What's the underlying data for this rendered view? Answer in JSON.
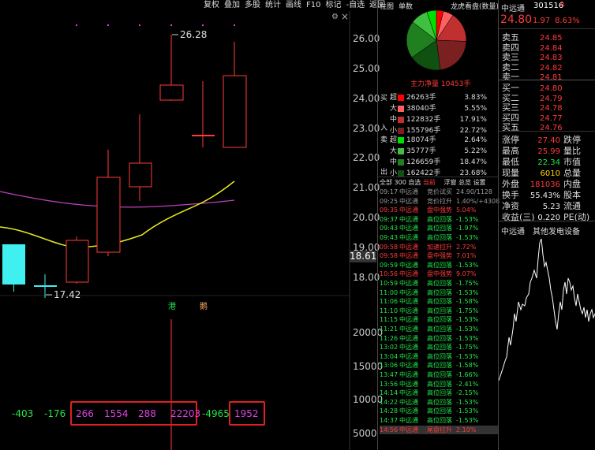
{
  "toolbar": {
    "items": [
      "复权",
      "叠加",
      "多股",
      "统计",
      "画线",
      "F10",
      "标记",
      "-自选",
      "返回"
    ]
  },
  "chart": {
    "price_axis": [
      "26.00",
      "25.00",
      "24.00",
      "23.00",
      "22.00",
      "21.00",
      "20.00",
      "19.00",
      "18.00"
    ],
    "current_price_tag": "18.61",
    "high_annot": "26.28",
    "low_annot": "17.42",
    "volume_axis": [
      "20000",
      "15000",
      "10000",
      "5000"
    ],
    "markers": {
      "gang": "港",
      "jing": "鹅"
    },
    "footer_values": [
      "-403",
      "-176",
      "266",
      "1554",
      "288",
      "22203",
      "-4965",
      "1952"
    ]
  },
  "mid": {
    "tabs": [
      "柱图",
      "单数"
    ],
    "pie_title": "龙虎看盘(数量)",
    "net_flow": "主力净量 10453手",
    "buy_label": "买",
    "sell_label": "卖",
    "in_label": "入",
    "out_label": "出",
    "buy_rows": [
      {
        "size": "超",
        "vol": "26263手",
        "pct": "3.83%",
        "color": "#ff0000"
      },
      {
        "size": "大",
        "vol": "38040手",
        "pct": "5.55%",
        "color": "#ff6060"
      },
      {
        "size": "中",
        "vol": "122832手",
        "pct": "17.91%",
        "color": "#c03030"
      },
      {
        "size": "小",
        "vol": "155796手",
        "pct": "22.72%",
        "color": "#7a2020"
      }
    ],
    "sell_rows": [
      {
        "size": "超",
        "vol": "18074手",
        "pct": "2.64%",
        "color": "#00e000"
      },
      {
        "size": "大",
        "vol": "35777手",
        "pct": "5.22%",
        "color": "#40c040"
      },
      {
        "size": "中",
        "vol": "126659手",
        "pct": "18.47%",
        "color": "#208020"
      },
      {
        "size": "小",
        "vol": "162422手",
        "pct": "23.68%",
        "color": "#105010"
      }
    ],
    "list_tabs": [
      "全部",
      "300",
      "自选",
      "当前",
      "浮窗",
      "总览",
      "设置"
    ],
    "events": [
      {
        "time": "09:17",
        "name": "中远通",
        "desc": "竞价试买",
        "val": "24.90/1128",
        "c": "gray"
      },
      {
        "time": "09:25",
        "name": "中远通",
        "desc": "竞价拉升",
        "val": "1.40%/+4308",
        "c": "gray"
      },
      {
        "time": "09:35",
        "name": "中远通",
        "desc": "盘中强势",
        "val": "5.04%",
        "c": "red"
      },
      {
        "time": "09:37",
        "name": "中远通",
        "desc": "高位回落",
        "val": "-1.53%",
        "c": "green"
      },
      {
        "time": "09:43",
        "name": "中远通",
        "desc": "高位回落",
        "val": "-1.97%",
        "c": "green"
      },
      {
        "time": "09:43",
        "name": "中远通",
        "desc": "高位回落",
        "val": "-1.53%",
        "c": "green"
      },
      {
        "time": "09:58",
        "name": "中远通",
        "desc": "加速拉升",
        "val": "2.72%",
        "c": "red"
      },
      {
        "time": "09:58",
        "name": "中远通",
        "desc": "盘中强势",
        "val": "7.01%",
        "c": "red"
      },
      {
        "time": "09:59",
        "name": "中远通",
        "desc": "高位回落",
        "val": "-1.53%",
        "c": "green"
      },
      {
        "time": "10:56",
        "name": "中远通",
        "desc": "盘中强势",
        "val": "9.07%",
        "c": "red"
      },
      {
        "time": "10:59",
        "name": "中远通",
        "desc": "高位回落",
        "val": "-1.75%",
        "c": "green"
      },
      {
        "time": "11:00",
        "name": "中远通",
        "desc": "高位回落",
        "val": "-1.53%",
        "c": "green"
      },
      {
        "time": "11:06",
        "name": "中远通",
        "desc": "高位回落",
        "val": "-1.58%",
        "c": "green"
      },
      {
        "time": "11:10",
        "name": "中远通",
        "desc": "高位回落",
        "val": "-1.75%",
        "c": "green"
      },
      {
        "time": "11:15",
        "name": "中远通",
        "desc": "高位回落",
        "val": "-1.53%",
        "c": "green"
      },
      {
        "time": "11:21",
        "name": "中远通",
        "desc": "高位回落",
        "val": "-1.53%",
        "c": "green"
      },
      {
        "time": "11:26",
        "name": "中远通",
        "desc": "高位回落",
        "val": "-1.53%",
        "c": "green"
      },
      {
        "time": "13:02",
        "name": "中远通",
        "desc": "高位回落",
        "val": "-1.75%",
        "c": "green"
      },
      {
        "time": "13:04",
        "name": "中远通",
        "desc": "高位回落",
        "val": "-1.53%",
        "c": "green"
      },
      {
        "time": "13:06",
        "name": "中远通",
        "desc": "高位回落",
        "val": "-1.58%",
        "c": "green"
      },
      {
        "time": "13:47",
        "name": "中远通",
        "desc": "高位回落",
        "val": "-1.66%",
        "c": "green"
      },
      {
        "time": "13:56",
        "name": "中远通",
        "desc": "高位回落",
        "val": "-2.41%",
        "c": "green"
      },
      {
        "time": "14:14",
        "name": "中远通",
        "desc": "高位回落",
        "val": "-2.15%",
        "c": "green"
      },
      {
        "time": "14:22",
        "name": "中远通",
        "desc": "高位回落",
        "val": "-1.53%",
        "c": "green"
      },
      {
        "time": "14:28",
        "name": "中远通",
        "desc": "高位回落",
        "val": "-1.53%",
        "c": "green"
      },
      {
        "time": "14:37",
        "name": "中远通",
        "desc": "高位回落",
        "val": "-1.53%",
        "c": "green"
      },
      {
        "time": "14:56",
        "name": "中远通",
        "desc": "尾盘拉升",
        "val": "2.10%",
        "c": "red"
      }
    ]
  },
  "quote": {
    "name": "中远通",
    "code": "301516",
    "badge": "R",
    "price": "24.80",
    "change": "1.97",
    "pct": "8.63%",
    "asks": [
      {
        "label": "卖五",
        "price": "24.85"
      },
      {
        "label": "卖四",
        "price": "24.84"
      },
      {
        "label": "卖三",
        "price": "24.83"
      },
      {
        "label": "卖二",
        "price": "24.82"
      },
      {
        "label": "卖一",
        "price": "24.81"
      }
    ],
    "bids": [
      {
        "label": "买一",
        "price": "24.80"
      },
      {
        "label": "买二",
        "price": "24.79"
      },
      {
        "label": "买三",
        "price": "24.78"
      },
      {
        "label": "买四",
        "price": "24.77"
      },
      {
        "label": "买五",
        "price": "24.76"
      }
    ],
    "stats": [
      {
        "k": "涨停",
        "v": "27.40",
        "c": "red",
        "k2": "跌停"
      },
      {
        "k": "最高",
        "v": "25.99",
        "c": "red",
        "k2": "量比"
      },
      {
        "k": "最低",
        "v": "22.34",
        "c": "green",
        "k2": "市值"
      },
      {
        "k": "现量",
        "v": "6010",
        "c": "yellow",
        "k2": "总量"
      },
      {
        "k": "外盘",
        "v": "181036",
        "c": "red",
        "k2": "内盘"
      },
      {
        "k": "换手",
        "v": "55.43%",
        "c": "white",
        "k2": "股本"
      },
      {
        "k": "净资",
        "v": "5.23",
        "c": "white",
        "k2": "流通"
      },
      {
        "k": "收益(三)",
        "v": "0.220",
        "c": "white",
        "k2": "PE(动)"
      }
    ],
    "mini_title": "中远通",
    "sector": "其他发电设备"
  },
  "colors": {
    "up": "#ff3a3a",
    "down": "#22e64a",
    "ma1": "#e0e040",
    "ma2": "#c040c0",
    "cyan": "#40f0f0"
  }
}
